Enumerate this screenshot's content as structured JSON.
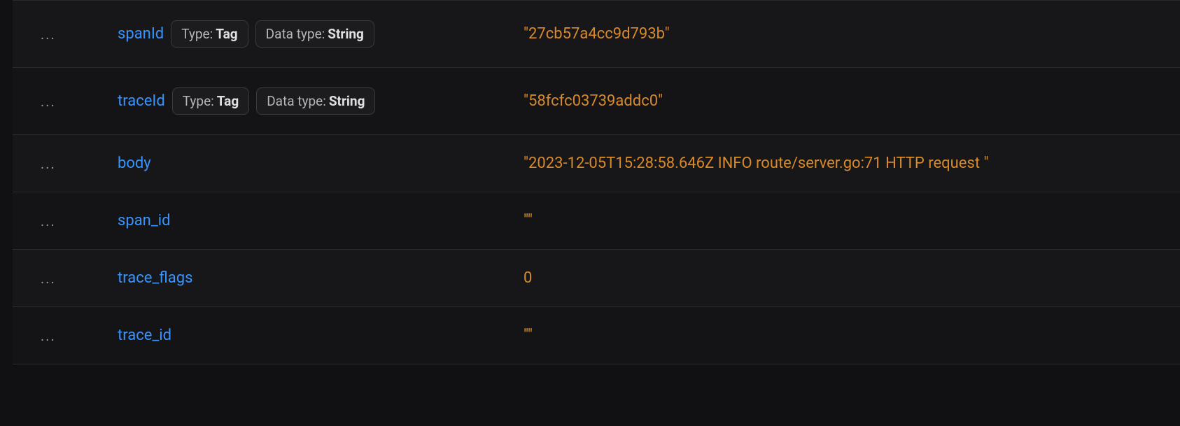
{
  "labels": {
    "dots": "...",
    "type_prefix": "Type:",
    "datatype_prefix": "Data type:"
  },
  "rows": [
    {
      "field": "spanId",
      "type": "Tag",
      "datatype": "String",
      "value": "\"27cb57a4cc9d793b\""
    },
    {
      "field": "traceId",
      "type": "Tag",
      "datatype": "String",
      "value": "\"58fcfc03739addc0\""
    },
    {
      "field": "body",
      "type": null,
      "datatype": null,
      "value": "\"2023-12-05T15:28:58.646Z INFO route/server.go:71 HTTP request \""
    },
    {
      "field": "span_id",
      "type": null,
      "datatype": null,
      "value": "\"\""
    },
    {
      "field": "trace_flags",
      "type": null,
      "datatype": null,
      "value": "0"
    },
    {
      "field": "trace_id",
      "type": null,
      "datatype": null,
      "value": "\"\""
    }
  ]
}
